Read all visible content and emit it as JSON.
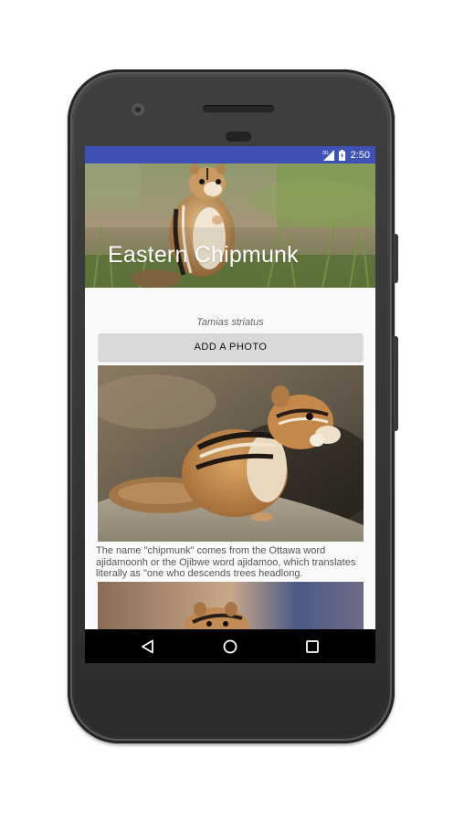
{
  "status_bar": {
    "network_label": "3G",
    "time": "2:50",
    "color": "#3f51b5"
  },
  "header": {
    "title": "Eastern Chipmunk"
  },
  "detail": {
    "scientific_name": "Tamias striatus",
    "add_photo_label": "ADD A PHOTO",
    "description": "The name \"chipmunk\" comes from the Ottawa word ajidamoonh or the Ojibwe word ajidamoo, which translates literally as \"one who descends trees headlong."
  },
  "nav_bar": {
    "back_icon": "back-triangle-icon",
    "home_icon": "home-circle-icon",
    "recents_icon": "recents-square-icon"
  }
}
